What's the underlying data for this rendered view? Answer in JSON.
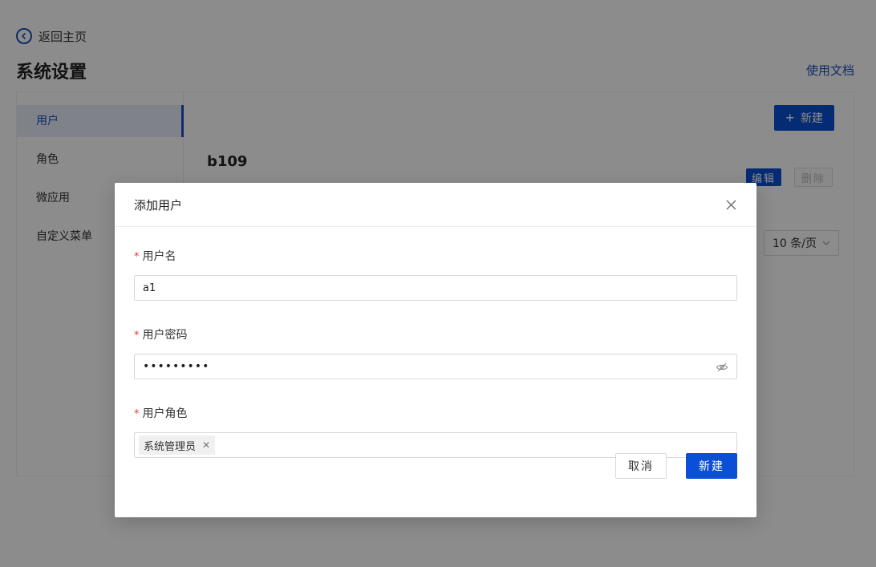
{
  "header": {
    "back_label": "返回主页",
    "title": "系统设置",
    "doc_link": "使用文档"
  },
  "sidebar": {
    "items": [
      {
        "label": "用户",
        "active": true
      },
      {
        "label": "角色",
        "active": false
      },
      {
        "label": "微应用",
        "active": false
      },
      {
        "label": "自定义菜单",
        "active": false
      }
    ]
  },
  "content": {
    "new_button": "新建",
    "user_name": "b109",
    "edit_button": "编辑",
    "delete_button": "删除",
    "page_size": "10 条/页"
  },
  "modal": {
    "title": "添加用户",
    "fields": {
      "username": {
        "label": "用户名",
        "value": "a1"
      },
      "password": {
        "label": "用户密码",
        "value": "•••••••••"
      },
      "role": {
        "label": "用户角色",
        "tag": "系统管理员"
      }
    },
    "cancel_button": "取消",
    "submit_button": "新建"
  },
  "colors": {
    "primary": "#0b4fd6",
    "link": "#1b4fbf",
    "required": "#e53935"
  }
}
